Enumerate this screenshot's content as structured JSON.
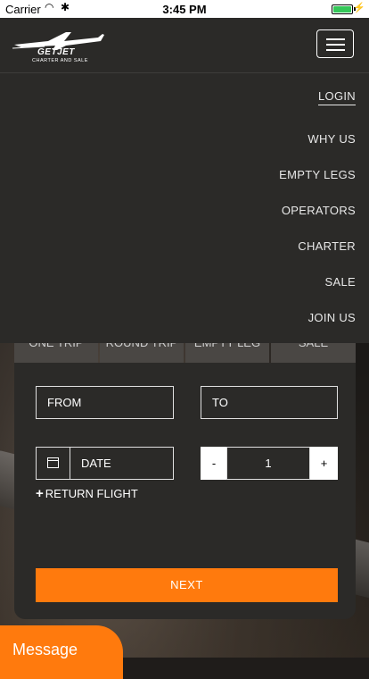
{
  "status_bar": {
    "carrier": "Carrier",
    "time": "3:45 PM"
  },
  "header": {
    "logo_brand": "GETJET",
    "logo_tagline": "CHARTER AND SALE"
  },
  "nav": {
    "items": [
      {
        "label": "LOGIN"
      },
      {
        "label": "WHY US"
      },
      {
        "label": "EMPTY LEGS"
      },
      {
        "label": "OPERATORS"
      },
      {
        "label": "CHARTER"
      },
      {
        "label": "SALE"
      },
      {
        "label": "JOIN US"
      }
    ]
  },
  "booking": {
    "tabs": [
      "ONE TRIP",
      "ROUND TRIP",
      "EMPTY LEG",
      "SALE"
    ],
    "from_placeholder": "FROM",
    "to_placeholder": "TO",
    "date_placeholder": "DATE",
    "passengers": "1",
    "minus_label": "-",
    "plus_label": "+",
    "return_label": "RETURN FLIGHT",
    "next_label": "NEXT"
  },
  "message": {
    "label": "Message"
  },
  "colors": {
    "accent": "#ff7a0d",
    "nav_bg": "#2b2a28"
  }
}
